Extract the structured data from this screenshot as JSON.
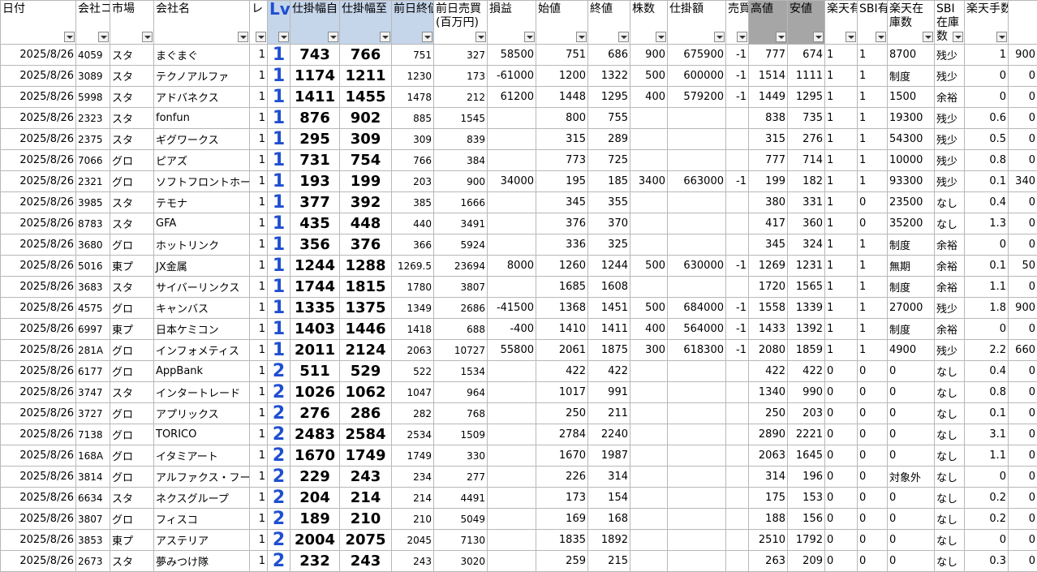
{
  "headers": [
    "日付",
    "会社コー",
    "市場",
    "会社名",
    "レ",
    "Lv",
    "仕掛幅自",
    "仕掛幅至",
    "前日終値",
    "前日売買(百万円)",
    "損益",
    "始値",
    "終値",
    "株数",
    "仕掛額",
    "売買",
    "高値",
    "安値",
    "楽天有",
    "SBI有",
    "楽天在庫数",
    "SBI在庫数",
    "楽天手数料",
    ""
  ],
  "rows": [
    [
      "2025/8/26",
      "4059",
      "スタ",
      "まぐまぐ",
      "1",
      "1",
      "743",
      "766",
      "751",
      "327",
      "58500",
      "751",
      "686",
      "900",
      "675900",
      "-1",
      "777",
      "674",
      "1",
      "1",
      "8700",
      "残少",
      "1",
      "900"
    ],
    [
      "2025/8/26",
      "3089",
      "スタ",
      "テクノアルファ",
      "1",
      "1",
      "1174",
      "1211",
      "1230",
      "173",
      "-61000",
      "1200",
      "1322",
      "500",
      "600000",
      "-1",
      "1514",
      "1111",
      "1",
      "1",
      "制度",
      "残少",
      "0",
      "0"
    ],
    [
      "2025/8/26",
      "5998",
      "スタ",
      "アドバネクス",
      "1",
      "1",
      "1411",
      "1455",
      "1478",
      "212",
      "61200",
      "1448",
      "1295",
      "400",
      "579200",
      "-1",
      "1449",
      "1295",
      "1",
      "1",
      "1500",
      "余裕",
      "0",
      "0"
    ],
    [
      "2025/8/26",
      "2323",
      "スタ",
      "fonfun",
      "1",
      "1",
      "876",
      "902",
      "885",
      "1545",
      "",
      "800",
      "755",
      "",
      "",
      "",
      "838",
      "735",
      "1",
      "1",
      "19300",
      "残少",
      "0.6",
      "0"
    ],
    [
      "2025/8/26",
      "2375",
      "スタ",
      "ギグワークス",
      "1",
      "1",
      "295",
      "309",
      "309",
      "839",
      "",
      "315",
      "289",
      "",
      "",
      "",
      "315",
      "276",
      "1",
      "1",
      "54300",
      "残少",
      "0.5",
      "0"
    ],
    [
      "2025/8/26",
      "7066",
      "グロ",
      "ピアズ",
      "1",
      "1",
      "731",
      "754",
      "766",
      "384",
      "",
      "773",
      "725",
      "",
      "",
      "",
      "777",
      "714",
      "1",
      "1",
      "10000",
      "残少",
      "0.8",
      "0"
    ],
    [
      "2025/8/26",
      "2321",
      "グロ",
      "ソフトフロントホールディングス",
      "1",
      "1",
      "193",
      "199",
      "203",
      "900",
      "34000",
      "195",
      "185",
      "3400",
      "663000",
      "-1",
      "199",
      "182",
      "1",
      "1",
      "93300",
      "残少",
      "0.1",
      "340"
    ],
    [
      "2025/8/26",
      "3985",
      "スタ",
      "テモナ",
      "1",
      "1",
      "377",
      "392",
      "385",
      "1666",
      "",
      "345",
      "355",
      "",
      "",
      "",
      "380",
      "331",
      "1",
      "0",
      "23500",
      "なし",
      "0.4",
      "0"
    ],
    [
      "2025/8/26",
      "8783",
      "スタ",
      "GFA",
      "1",
      "1",
      "435",
      "448",
      "440",
      "3491",
      "",
      "376",
      "370",
      "",
      "",
      "",
      "417",
      "360",
      "1",
      "0",
      "35200",
      "なし",
      "1.3",
      "0"
    ],
    [
      "2025/8/26",
      "3680",
      "グロ",
      "ホットリンク",
      "1",
      "1",
      "356",
      "376",
      "366",
      "5924",
      "",
      "336",
      "325",
      "",
      "",
      "",
      "345",
      "324",
      "1",
      "1",
      "制度",
      "余裕",
      "0",
      "0"
    ],
    [
      "2025/8/26",
      "5016",
      "東プ",
      "JX金属",
      "1",
      "1",
      "1244",
      "1288",
      "1269.5",
      "23694",
      "8000",
      "1260",
      "1244",
      "500",
      "630000",
      "-1",
      "1269",
      "1231",
      "1",
      "1",
      "無期",
      "余裕",
      "0.1",
      "50"
    ],
    [
      "2025/8/26",
      "3683",
      "スタ",
      "サイバーリンクス",
      "1",
      "1",
      "1744",
      "1815",
      "1780",
      "3807",
      "",
      "1685",
      "1608",
      "",
      "",
      "",
      "1720",
      "1565",
      "1",
      "1",
      "制度",
      "余裕",
      "1.1",
      "0"
    ],
    [
      "2025/8/26",
      "4575",
      "グロ",
      "キャンバス",
      "1",
      "1",
      "1335",
      "1375",
      "1349",
      "2686",
      "-41500",
      "1368",
      "1451",
      "500",
      "684000",
      "-1",
      "1558",
      "1339",
      "1",
      "1",
      "27000",
      "残少",
      "1.8",
      "900"
    ],
    [
      "2025/8/26",
      "6997",
      "東プ",
      "日本ケミコン",
      "1",
      "1",
      "1403",
      "1446",
      "1418",
      "688",
      "-400",
      "1410",
      "1411",
      "400",
      "564000",
      "-1",
      "1433",
      "1392",
      "1",
      "1",
      "制度",
      "余裕",
      "0",
      "0"
    ],
    [
      "2025/8/26",
      "281A",
      "グロ",
      "インフォメティス",
      "1",
      "1",
      "2011",
      "2124",
      "2063",
      "10727",
      "55800",
      "2061",
      "1875",
      "300",
      "618300",
      "-1",
      "2080",
      "1859",
      "1",
      "1",
      "4900",
      "残少",
      "2.2",
      "660"
    ],
    [
      "2025/8/26",
      "6177",
      "グロ",
      "AppBank",
      "1",
      "2",
      "511",
      "529",
      "522",
      "1534",
      "",
      "422",
      "422",
      "",
      "",
      "",
      "422",
      "422",
      "0",
      "0",
      "0",
      "なし",
      "0.4",
      "0"
    ],
    [
      "2025/8/26",
      "3747",
      "スタ",
      "インタートレード",
      "1",
      "2",
      "1026",
      "1062",
      "1047",
      "964",
      "",
      "1017",
      "991",
      "",
      "",
      "",
      "1340",
      "990",
      "0",
      "0",
      "0",
      "なし",
      "0.8",
      "0"
    ],
    [
      "2025/8/26",
      "3727",
      "グロ",
      "アプリックス",
      "1",
      "2",
      "276",
      "286",
      "282",
      "768",
      "",
      "250",
      "211",
      "",
      "",
      "",
      "250",
      "203",
      "0",
      "0",
      "0",
      "なし",
      "0.1",
      "0"
    ],
    [
      "2025/8/26",
      "7138",
      "グロ",
      "TORICO",
      "1",
      "2",
      "2483",
      "2584",
      "2534",
      "1509",
      "",
      "2784",
      "2240",
      "",
      "",
      "",
      "2890",
      "2221",
      "0",
      "0",
      "0",
      "なし",
      "3.1",
      "0"
    ],
    [
      "2025/8/26",
      "168A",
      "グロ",
      "イタミアート",
      "1",
      "2",
      "1670",
      "1749",
      "1749",
      "330",
      "",
      "1670",
      "1987",
      "",
      "",
      "",
      "2063",
      "1645",
      "0",
      "0",
      "0",
      "なし",
      "1.1",
      "0"
    ],
    [
      "2025/8/26",
      "3814",
      "グロ",
      "アルファクス・フード・システム",
      "1",
      "2",
      "229",
      "243",
      "234",
      "277",
      "",
      "226",
      "314",
      "",
      "",
      "",
      "314",
      "196",
      "0",
      "0",
      "対象外",
      "なし",
      "0",
      "0"
    ],
    [
      "2025/8/26",
      "6634",
      "スタ",
      "ネクスグループ",
      "1",
      "2",
      "204",
      "214",
      "214",
      "4491",
      "",
      "173",
      "154",
      "",
      "",
      "",
      "175",
      "153",
      "0",
      "0",
      "0",
      "なし",
      "0.2",
      "0"
    ],
    [
      "2025/8/26",
      "3807",
      "グロ",
      "フィスコ",
      "1",
      "2",
      "189",
      "210",
      "210",
      "5049",
      "",
      "169",
      "168",
      "",
      "",
      "",
      "188",
      "156",
      "0",
      "0",
      "0",
      "なし",
      "0.2",
      "0"
    ],
    [
      "2025/8/26",
      "3853",
      "東プ",
      "アステリア",
      "1",
      "2",
      "2004",
      "2075",
      "2045",
      "7130",
      "",
      "1835",
      "1892",
      "",
      "",
      "",
      "2510",
      "1792",
      "0",
      "0",
      "0",
      "なし",
      "0",
      "0"
    ],
    [
      "2025/8/26",
      "2673",
      "スタ",
      "夢みつけ隊",
      "1",
      "2",
      "232",
      "243",
      "243",
      "3020",
      "",
      "259",
      "215",
      "",
      "",
      "",
      "263",
      "209",
      "0",
      "0",
      "0",
      "なし",
      "0.3",
      "0"
    ]
  ]
}
